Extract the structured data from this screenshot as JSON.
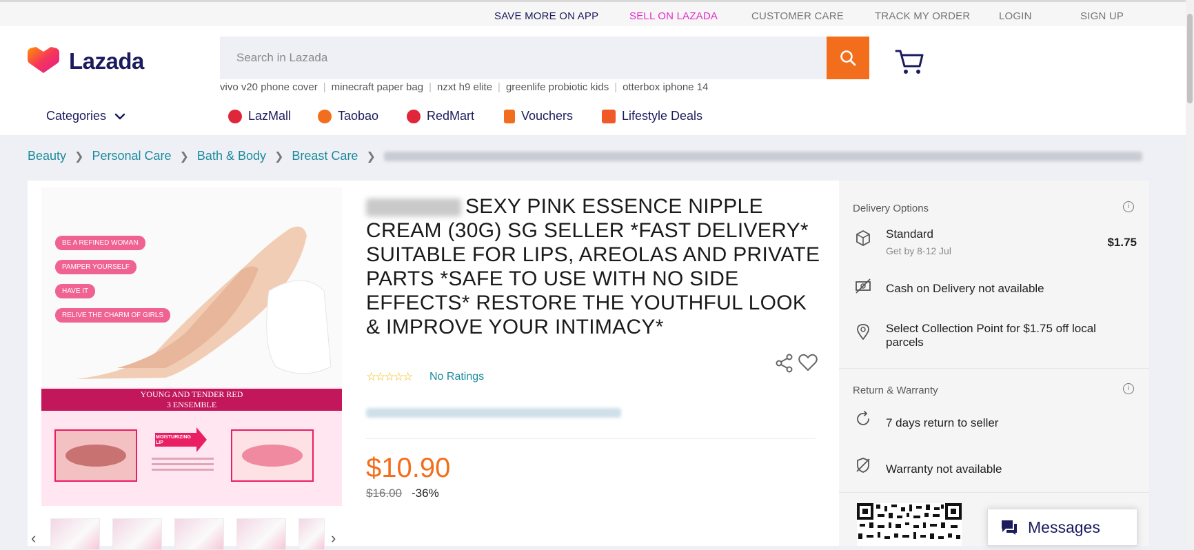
{
  "topbar": {
    "links": [
      {
        "label": "SAVE MORE ON APP",
        "style": "dark"
      },
      {
        "label": "SELL ON LAZADA",
        "style": "pink"
      },
      {
        "label": "CUSTOMER CARE",
        "style": "gray"
      },
      {
        "label": "TRACK MY ORDER",
        "style": "gray"
      },
      {
        "label": "LOGIN",
        "style": "gray"
      },
      {
        "label": "SIGN UP",
        "style": "gray"
      }
    ]
  },
  "header": {
    "logo_text": "Lazada",
    "search": {
      "placeholder": "Search in Lazada",
      "value": ""
    },
    "suggestions": [
      "vivo v20 phone cover",
      "minecraft paper bag",
      "nzxt h9 elite",
      "greenlife probiotic kids",
      "otterbox iphone 14"
    ],
    "categories_label": "Categories",
    "nav": [
      {
        "label": "LazMall",
        "icon": "lazmall-icon",
        "color": "#e0263b"
      },
      {
        "label": "Taobao",
        "icon": "taobao-icon",
        "color": "#f36e1c"
      },
      {
        "label": "RedMart",
        "icon": "redmart-icon",
        "color": "#e0263b"
      },
      {
        "label": "Vouchers",
        "icon": "voucher-icon",
        "color": "#f36e1c"
      },
      {
        "label": "Lifestyle Deals",
        "icon": "lifestyle-icon",
        "color": "#f05a28"
      }
    ]
  },
  "breadcrumb": {
    "items": [
      "Beauty",
      "Personal Care",
      "Bath & Body",
      "Breast Care"
    ]
  },
  "product": {
    "title": "SEXY PINK ESSENCE NIPPLE CREAM (30G) SG SELLER *FAST DELIVERY* SUITABLE FOR LIPS, AREOLAS AND PRIVATE PARTS *SAFE TO USE WITH NO SIDE EFFECTS* RESTORE THE YOUTHFUL LOOK & IMPROVE YOUR INTIMACY*",
    "ratings_label": "No Ratings",
    "rating_stars": 0,
    "price": "$10.90",
    "original_price": "$16.00",
    "discount": "-36%",
    "gallery": {
      "tags": [
        "BE A REFINED WOMAN",
        "PAMPER YOURSELF",
        "HAVE IT",
        "RELIVE THE CHARM OF GIRLS"
      ],
      "banner_line1": "YOUNG AND TENDER RED",
      "banner_line2": "3 ENSEMBLE",
      "arrow_label": "MOISTURIZING LIP"
    }
  },
  "delivery": {
    "header": "Delivery Options",
    "standard_label": "Standard",
    "standard_eta": "Get by 8-12 Jul",
    "standard_price": "$1.75",
    "cod": "Cash on Delivery not available",
    "collection": "Select Collection Point for $1.75 off local parcels"
  },
  "warranty": {
    "header": "Return & Warranty",
    "returns": "7 days return to seller",
    "warranty": "Warranty not available"
  },
  "messages_label": "Messages",
  "colors": {
    "brand_orange": "#f36e1c",
    "brand_navy": "#1b1b5e",
    "link_teal": "#1a8a9c",
    "pink": "#e52ac6"
  }
}
